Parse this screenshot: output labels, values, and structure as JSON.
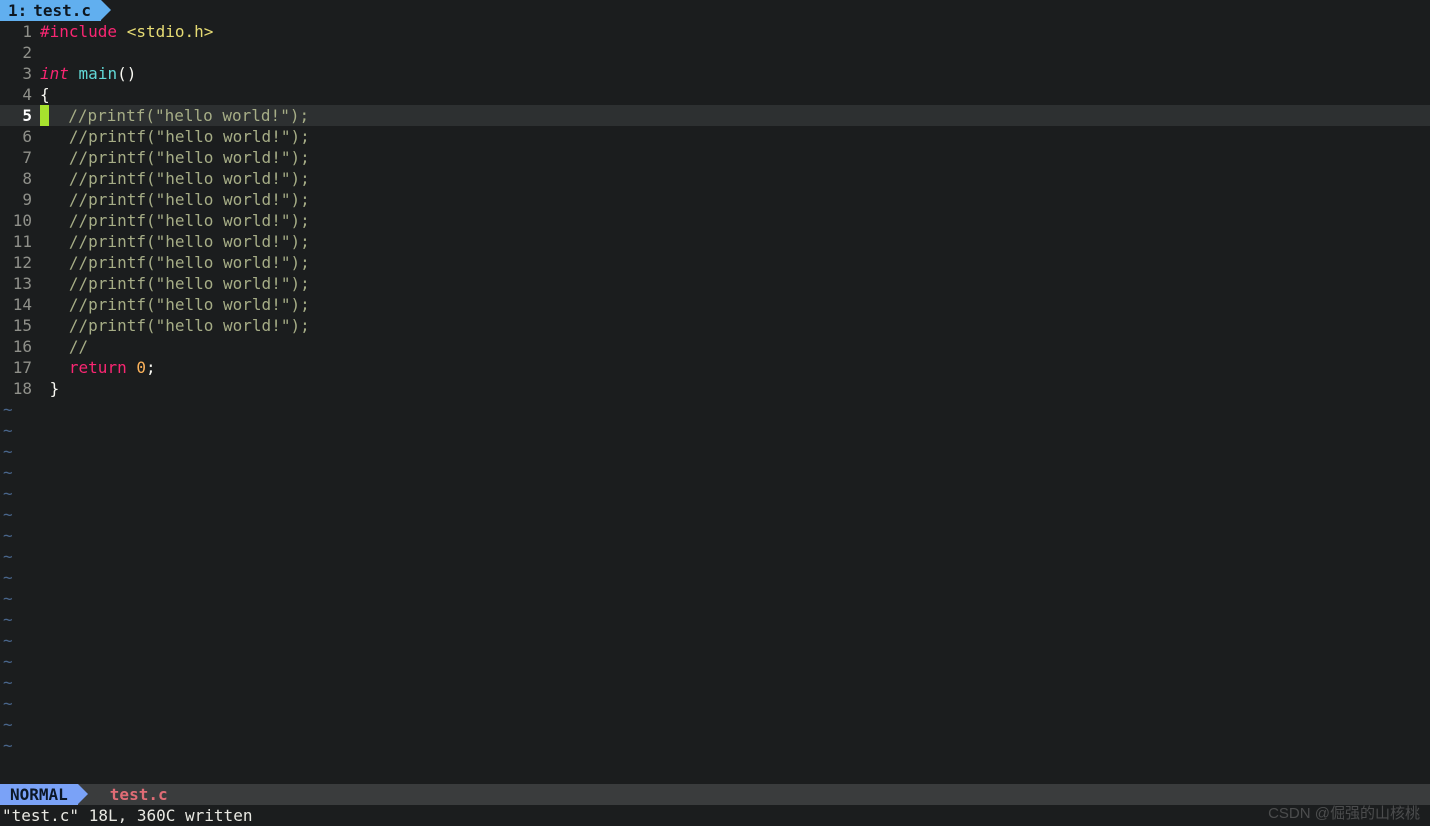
{
  "tab": {
    "index": "1:",
    "filename": "test.c"
  },
  "code": {
    "current_line": 5,
    "total_lines": 18,
    "tilde_rows": 17,
    "lines": [
      {
        "n": 1,
        "tokens": [
          {
            "c": "tk-pre",
            "t": "#include"
          },
          {
            "c": "tk-punc",
            "t": " "
          },
          {
            "c": "tk-hdr",
            "t": "<stdio.h>"
          }
        ]
      },
      {
        "n": 2,
        "tokens": []
      },
      {
        "n": 3,
        "tokens": [
          {
            "c": "tk-type",
            "t": "int"
          },
          {
            "c": "tk-punc",
            "t": " "
          },
          {
            "c": "tk-func",
            "t": "main"
          },
          {
            "c": "tk-punc",
            "t": "()"
          }
        ]
      },
      {
        "n": 4,
        "tokens": [
          {
            "c": "tk-punc",
            "t": "{"
          }
        ]
      },
      {
        "n": 5,
        "cursor": true,
        "tokens": [
          {
            "c": "tk-cmt",
            "t": "  //printf(\"hello world!\");"
          }
        ]
      },
      {
        "n": 6,
        "tokens": [
          {
            "c": "tk-cmt",
            "t": "   //printf(\"hello world!\");"
          }
        ]
      },
      {
        "n": 7,
        "tokens": [
          {
            "c": "tk-cmt",
            "t": "   //printf(\"hello world!\");"
          }
        ]
      },
      {
        "n": 8,
        "tokens": [
          {
            "c": "tk-cmt",
            "t": "   //printf(\"hello world!\");"
          }
        ]
      },
      {
        "n": 9,
        "tokens": [
          {
            "c": "tk-cmt",
            "t": "   //printf(\"hello world!\");"
          }
        ]
      },
      {
        "n": 10,
        "tokens": [
          {
            "c": "tk-cmt",
            "t": "   //printf(\"hello world!\");"
          }
        ]
      },
      {
        "n": 11,
        "tokens": [
          {
            "c": "tk-cmt",
            "t": "   //printf(\"hello world!\");"
          }
        ]
      },
      {
        "n": 12,
        "tokens": [
          {
            "c": "tk-cmt",
            "t": "   //printf(\"hello world!\");"
          }
        ]
      },
      {
        "n": 13,
        "tokens": [
          {
            "c": "tk-cmt",
            "t": "   //printf(\"hello world!\");"
          }
        ]
      },
      {
        "n": 14,
        "tokens": [
          {
            "c": "tk-cmt",
            "t": "   //printf(\"hello world!\");"
          }
        ]
      },
      {
        "n": 15,
        "tokens": [
          {
            "c": "tk-cmt",
            "t": "   //printf(\"hello world!\");"
          }
        ]
      },
      {
        "n": 16,
        "tokens": [
          {
            "c": "tk-cmt",
            "t": "   //"
          }
        ]
      },
      {
        "n": 17,
        "tokens": [
          {
            "c": "tk-punc",
            "t": "   "
          },
          {
            "c": "tk-kw",
            "t": "return"
          },
          {
            "c": "tk-punc",
            "t": " "
          },
          {
            "c": "tk-num",
            "t": "0"
          },
          {
            "c": "tk-punc",
            "t": ";"
          }
        ]
      },
      {
        "n": 18,
        "tokens": [
          {
            "c": "tk-punc",
            "t": " }"
          }
        ]
      }
    ]
  },
  "status": {
    "mode": "NORMAL",
    "filename": "test.c"
  },
  "cmd": {
    "message": "\"test.c\" 18L, 360C written"
  },
  "watermark": "CSDN @倔强的山核桃"
}
